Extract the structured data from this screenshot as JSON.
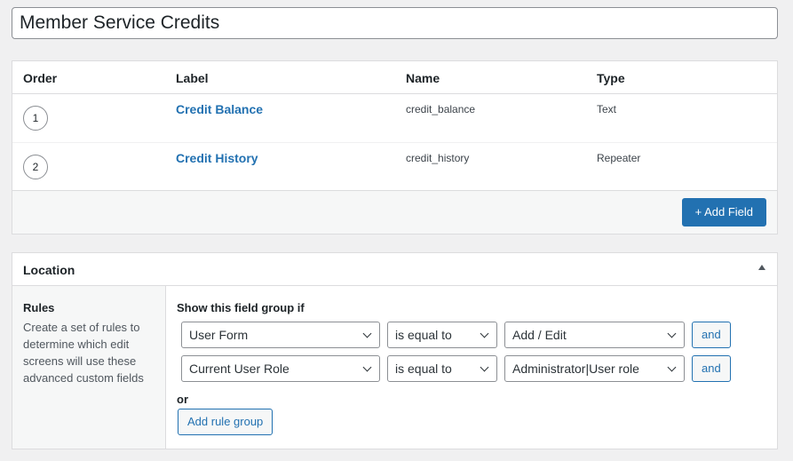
{
  "title_input": {
    "value": "Member Service Credits"
  },
  "fields": {
    "columns": {
      "order": "Order",
      "label": "Label",
      "name": "Name",
      "type": "Type"
    },
    "rows": [
      {
        "order": "1",
        "label": "Credit Balance",
        "name": "credit_balance",
        "type": "Text"
      },
      {
        "order": "2",
        "label": "Credit History",
        "name": "credit_history",
        "type": "Repeater"
      }
    ],
    "add_field_label": "+ Add Field"
  },
  "location": {
    "title": "Location",
    "rules_title": "Rules",
    "rules_description": "Create a set of rules to determine which edit screens will use these advanced custom fields",
    "show_if_label": "Show this field group if",
    "rules": [
      {
        "param": "User Form",
        "operator": "is equal to",
        "value": "Add / Edit",
        "and_label": "and"
      },
      {
        "param": "Current User Role",
        "operator": "is equal to",
        "value": "Administrator|User role",
        "and_label": "and"
      }
    ],
    "or_label": "or",
    "add_rule_group_label": "Add rule group"
  },
  "colors": {
    "accent": "#2271b1",
    "background": "#f0f0f1",
    "panel": "#ffffff",
    "border": "#dcdcde"
  },
  "icons": [
    "collapse-arrow-icon",
    "chevron-down-icon"
  ]
}
